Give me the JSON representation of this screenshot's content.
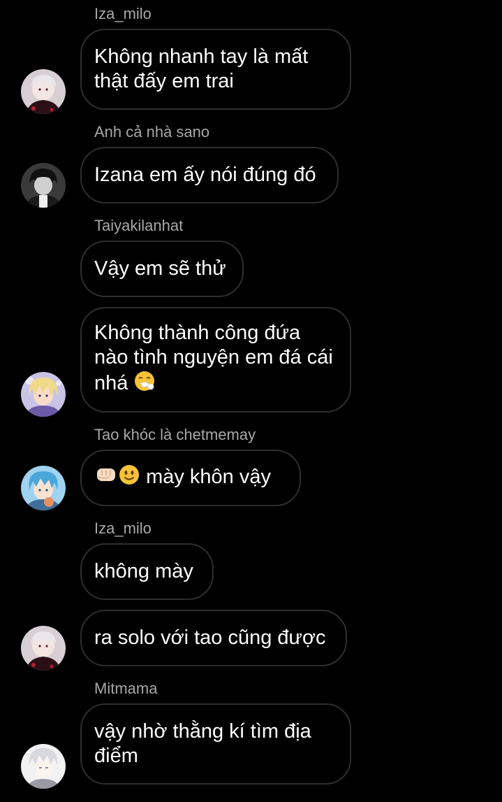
{
  "messages": [
    {
      "sender": "Iza_milo",
      "lines": [
        "Không nhanh tay là mất",
        "thật đấy em trai"
      ]
    },
    {
      "sender": "Anh cả nhà sano",
      "lines": [
        "Izana em ấy nói đúng đó"
      ]
    },
    {
      "sender": "Taiyakilanhat",
      "lines": [
        "Vậy em sẽ thử"
      ],
      "lines2": [
        "Không thành công đứa",
        "nào tình nguyện em đá cái",
        "nhá"
      ]
    },
    {
      "sender": "Tao khóc là chetmemay",
      "lines": [
        "mày khôn vậy"
      ]
    },
    {
      "sender": "Iza_milo",
      "lines": [
        "không mày"
      ],
      "lines2": [
        "ra solo với tao cũng được"
      ]
    },
    {
      "sender": "Mitmama",
      "lines": [
        "vậy nhờ thằng kí tìm địa",
        "điểm"
      ]
    }
  ],
  "avatars": {
    "izana": {
      "name": "avatar-iza-milo",
      "bg": "#d8cfd4",
      "hair": "#eae6ea",
      "accent": "#5a1e28"
    },
    "sano": {
      "name": "avatar-anh-ca-nha-sano",
      "bg": "#3a3a3a",
      "hair": "#111111",
      "accent": "#cfcfcf"
    },
    "taiyaki": {
      "name": "avatar-taiyakilanhat",
      "bg": "#c9c4e6",
      "hair": "#f1d98a",
      "accent": "#6b5aa8"
    },
    "tao": {
      "name": "avatar-tao-khoc",
      "bg": "#9fd3ef",
      "hair": "#4aa6d8",
      "accent": "#e89060"
    },
    "mitmama": {
      "name": "avatar-mitmama",
      "bg": "#f2f2f2",
      "hair": "#d8d8df",
      "accent": "#9a9aa6"
    }
  },
  "emoji": {
    "sneeze": "sneezing-face-emoji",
    "fist": "oncoming-fist-emoji",
    "smile": "slightly-smiling-face-emoji"
  },
  "colors": {
    "background": "#000000",
    "bubble_border": "#2e2e2e",
    "sender_name": "#a8a8a8",
    "text": "#ffffff"
  }
}
